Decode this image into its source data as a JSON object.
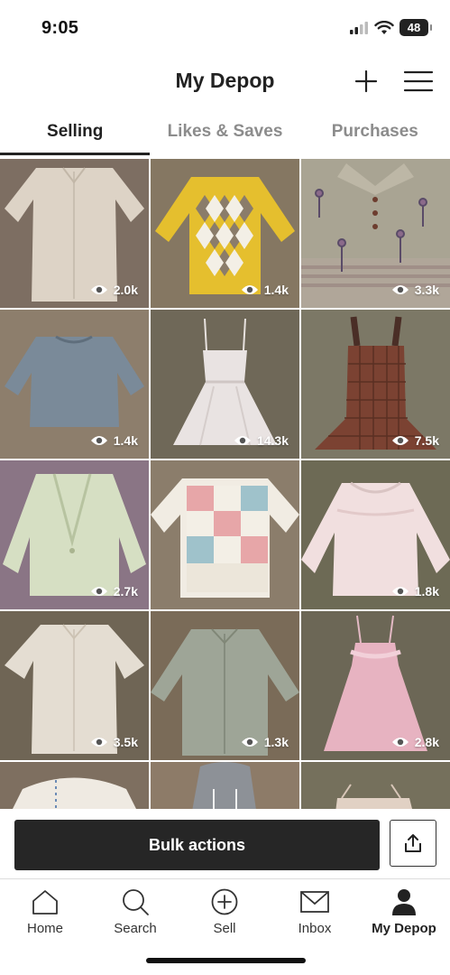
{
  "status_bar": {
    "time": "9:05",
    "battery": "48"
  },
  "header": {
    "title": "My Depop"
  },
  "tabs": [
    {
      "label": "Selling",
      "active": true
    },
    {
      "label": "Likes & Saves",
      "active": false
    },
    {
      "label": "Purchases",
      "active": false
    }
  ],
  "items": [
    {
      "views": "2.0k",
      "desc": "beige button-up shirt"
    },
    {
      "views": "1.4k",
      "desc": "yellow argyle sweater"
    },
    {
      "views": "3.3k",
      "desc": "grey floral polo sweater"
    },
    {
      "views": "1.4k",
      "desc": "grey knit sweater"
    },
    {
      "views": "14.3k",
      "desc": "white satin dress"
    },
    {
      "views": "7.5k",
      "desc": "brown plaid pinafore dress"
    },
    {
      "views": "2.7k",
      "desc": "sage green blazer"
    },
    {
      "views": "",
      "desc": "patchwork floral sweater"
    },
    {
      "views": "1.8k",
      "desc": "pink ruffle blouse"
    },
    {
      "views": "3.5k",
      "desc": "cream short sleeve shirt"
    },
    {
      "views": "1.3k",
      "desc": "sage button-up shirt"
    },
    {
      "views": "2.8k",
      "desc": "pink slip dress"
    },
    {
      "views": "",
      "desc": "cream cardigan"
    },
    {
      "views": "",
      "desc": "grey hoodie"
    },
    {
      "views": "",
      "desc": "cream top"
    }
  ],
  "action_bar": {
    "bulk_label": "Bulk actions"
  },
  "nav": [
    {
      "label": "Home",
      "icon": "home-icon"
    },
    {
      "label": "Search",
      "icon": "search-icon"
    },
    {
      "label": "Sell",
      "icon": "sell-icon"
    },
    {
      "label": "Inbox",
      "icon": "inbox-icon"
    },
    {
      "label": "My Depop",
      "icon": "profile-icon",
      "active": true
    }
  ]
}
